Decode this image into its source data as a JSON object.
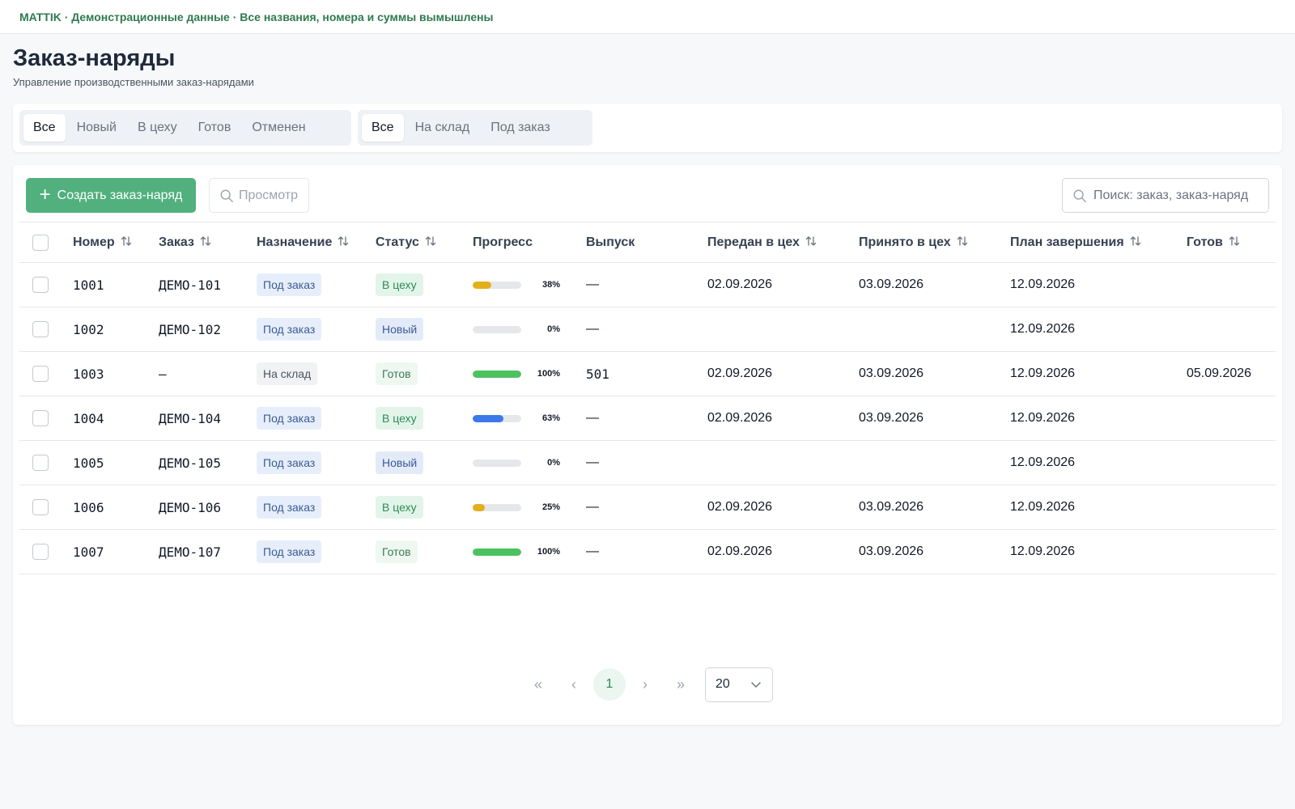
{
  "banner": {
    "text": "MATTIK · Демонстрационные данные · Все названия, номера и суммы вымышлены"
  },
  "page": {
    "title": "Заказ-наряды",
    "subtitle": "Управление производственными заказ-нарядами"
  },
  "filters": {
    "status": [
      "Все",
      "Новый",
      "В цеху",
      "Готов",
      "Отменен"
    ],
    "status_active": "Все",
    "destination": [
      "Все",
      "На склад",
      "Под заказ"
    ],
    "destination_active": "Все"
  },
  "toolbar": {
    "create_label": "Создать заказ-наряд",
    "view_label": "Просмотр",
    "search_placeholder": "Поиск: заказ, заказ-наряд"
  },
  "columns": [
    "Номер",
    "Заказ",
    "Назначение",
    "Статус",
    "Прогресс",
    "Выпуск",
    "Передан в цех",
    "Принято в цех",
    "План завершения",
    "Готов"
  ],
  "rows": [
    {
      "number": "1001",
      "order": "ДЕМО-101",
      "destination": "Под заказ",
      "status": "В цеху",
      "progress": 38,
      "progress_label": "38%",
      "progress_color": "#e3b01c",
      "release": "—",
      "sent": "02.09.2026",
      "accepted": "03.09.2026",
      "plan": "12.09.2026",
      "done": ""
    },
    {
      "number": "1002",
      "order": "ДЕМО-102",
      "destination": "Под заказ",
      "status": "Новый",
      "progress": 0,
      "progress_label": "0%",
      "progress_color": "#e3b01c",
      "release": "—",
      "sent": "",
      "accepted": "",
      "plan": "12.09.2026",
      "done": ""
    },
    {
      "number": "1003",
      "order": "—",
      "destination": "На склад",
      "status": "Готов",
      "progress": 100,
      "progress_label": "100%",
      "progress_color": "#4cc25f",
      "release": "501",
      "sent": "02.09.2026",
      "accepted": "03.09.2026",
      "plan": "12.09.2026",
      "done": "05.09.2026"
    },
    {
      "number": "1004",
      "order": "ДЕМО-104",
      "destination": "Под заказ",
      "status": "В цеху",
      "progress": 63,
      "progress_label": "63%",
      "progress_color": "#3b7ae8",
      "release": "—",
      "sent": "02.09.2026",
      "accepted": "03.09.2026",
      "plan": "12.09.2026",
      "done": ""
    },
    {
      "number": "1005",
      "order": "ДЕМО-105",
      "destination": "Под заказ",
      "status": "Новый",
      "progress": 0,
      "progress_label": "0%",
      "progress_color": "#e3b01c",
      "release": "—",
      "sent": "",
      "accepted": "",
      "plan": "12.09.2026",
      "done": ""
    },
    {
      "number": "1006",
      "order": "ДЕМО-106",
      "destination": "Под заказ",
      "status": "В цеху",
      "progress": 25,
      "progress_label": "25%",
      "progress_color": "#e3b01c",
      "release": "—",
      "sent": "02.09.2026",
      "accepted": "03.09.2026",
      "plan": "12.09.2026",
      "done": ""
    },
    {
      "number": "1007",
      "order": "ДЕМО-107",
      "destination": "Под заказ",
      "status": "Готов",
      "progress": 100,
      "progress_label": "100%",
      "progress_color": "#4cc25f",
      "release": "—",
      "sent": "02.09.2026",
      "accepted": "03.09.2026",
      "plan": "12.09.2026",
      "done": ""
    }
  ],
  "pagination": {
    "first": "«",
    "prev": "‹",
    "current": "1",
    "next": "›",
    "last": "»",
    "page_size": "20"
  },
  "icons": {
    "create": "plus-icon",
    "view": "search-icon",
    "search": "search-icon",
    "sort": "sort-icon",
    "page_size": "chevron-down-icon"
  },
  "colors": {
    "accent": "#52b07f",
    "banner": "#2f7a4f"
  }
}
